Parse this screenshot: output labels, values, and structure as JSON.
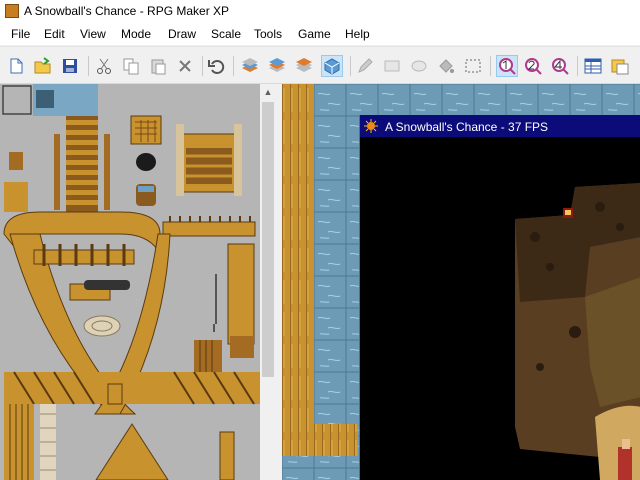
{
  "window": {
    "title": "A Snowball's Chance - RPG Maker XP"
  },
  "menu": {
    "items": [
      "File",
      "Edit",
      "View",
      "Mode",
      "Draw",
      "Scale",
      "Tools",
      "Game",
      "Help"
    ]
  },
  "toolbar": {
    "buttons": [
      {
        "name": "new-project-icon"
      },
      {
        "name": "open-project-icon"
      },
      {
        "name": "save-project-icon"
      },
      {
        "name": "cut-icon"
      },
      {
        "name": "copy-icon"
      },
      {
        "name": "paste-icon"
      },
      {
        "name": "delete-icon"
      },
      {
        "name": "undo-icon"
      },
      {
        "name": "layer-1-icon"
      },
      {
        "name": "layer-2-icon"
      },
      {
        "name": "layer-3-icon"
      },
      {
        "name": "events-layer-icon",
        "active": true
      },
      {
        "name": "pencil-icon"
      },
      {
        "name": "rectangle-icon"
      },
      {
        "name": "ellipse-icon"
      },
      {
        "name": "flood-fill-icon"
      },
      {
        "name": "select-icon"
      },
      {
        "name": "zoom-1-1-icon",
        "active": true
      },
      {
        "name": "zoom-1-2-icon"
      },
      {
        "name": "zoom-1-4-icon"
      },
      {
        "name": "database-icon"
      },
      {
        "name": "materialbase-icon"
      }
    ]
  },
  "game_window": {
    "title": "A Snowball's Chance - 37 FPS"
  },
  "colors": {
    "game_title_bar": "#0b0b7a",
    "tileset_background": "#b5b5b5",
    "wood": "#c8922e",
    "stone_blue": "#6d9bb6"
  }
}
